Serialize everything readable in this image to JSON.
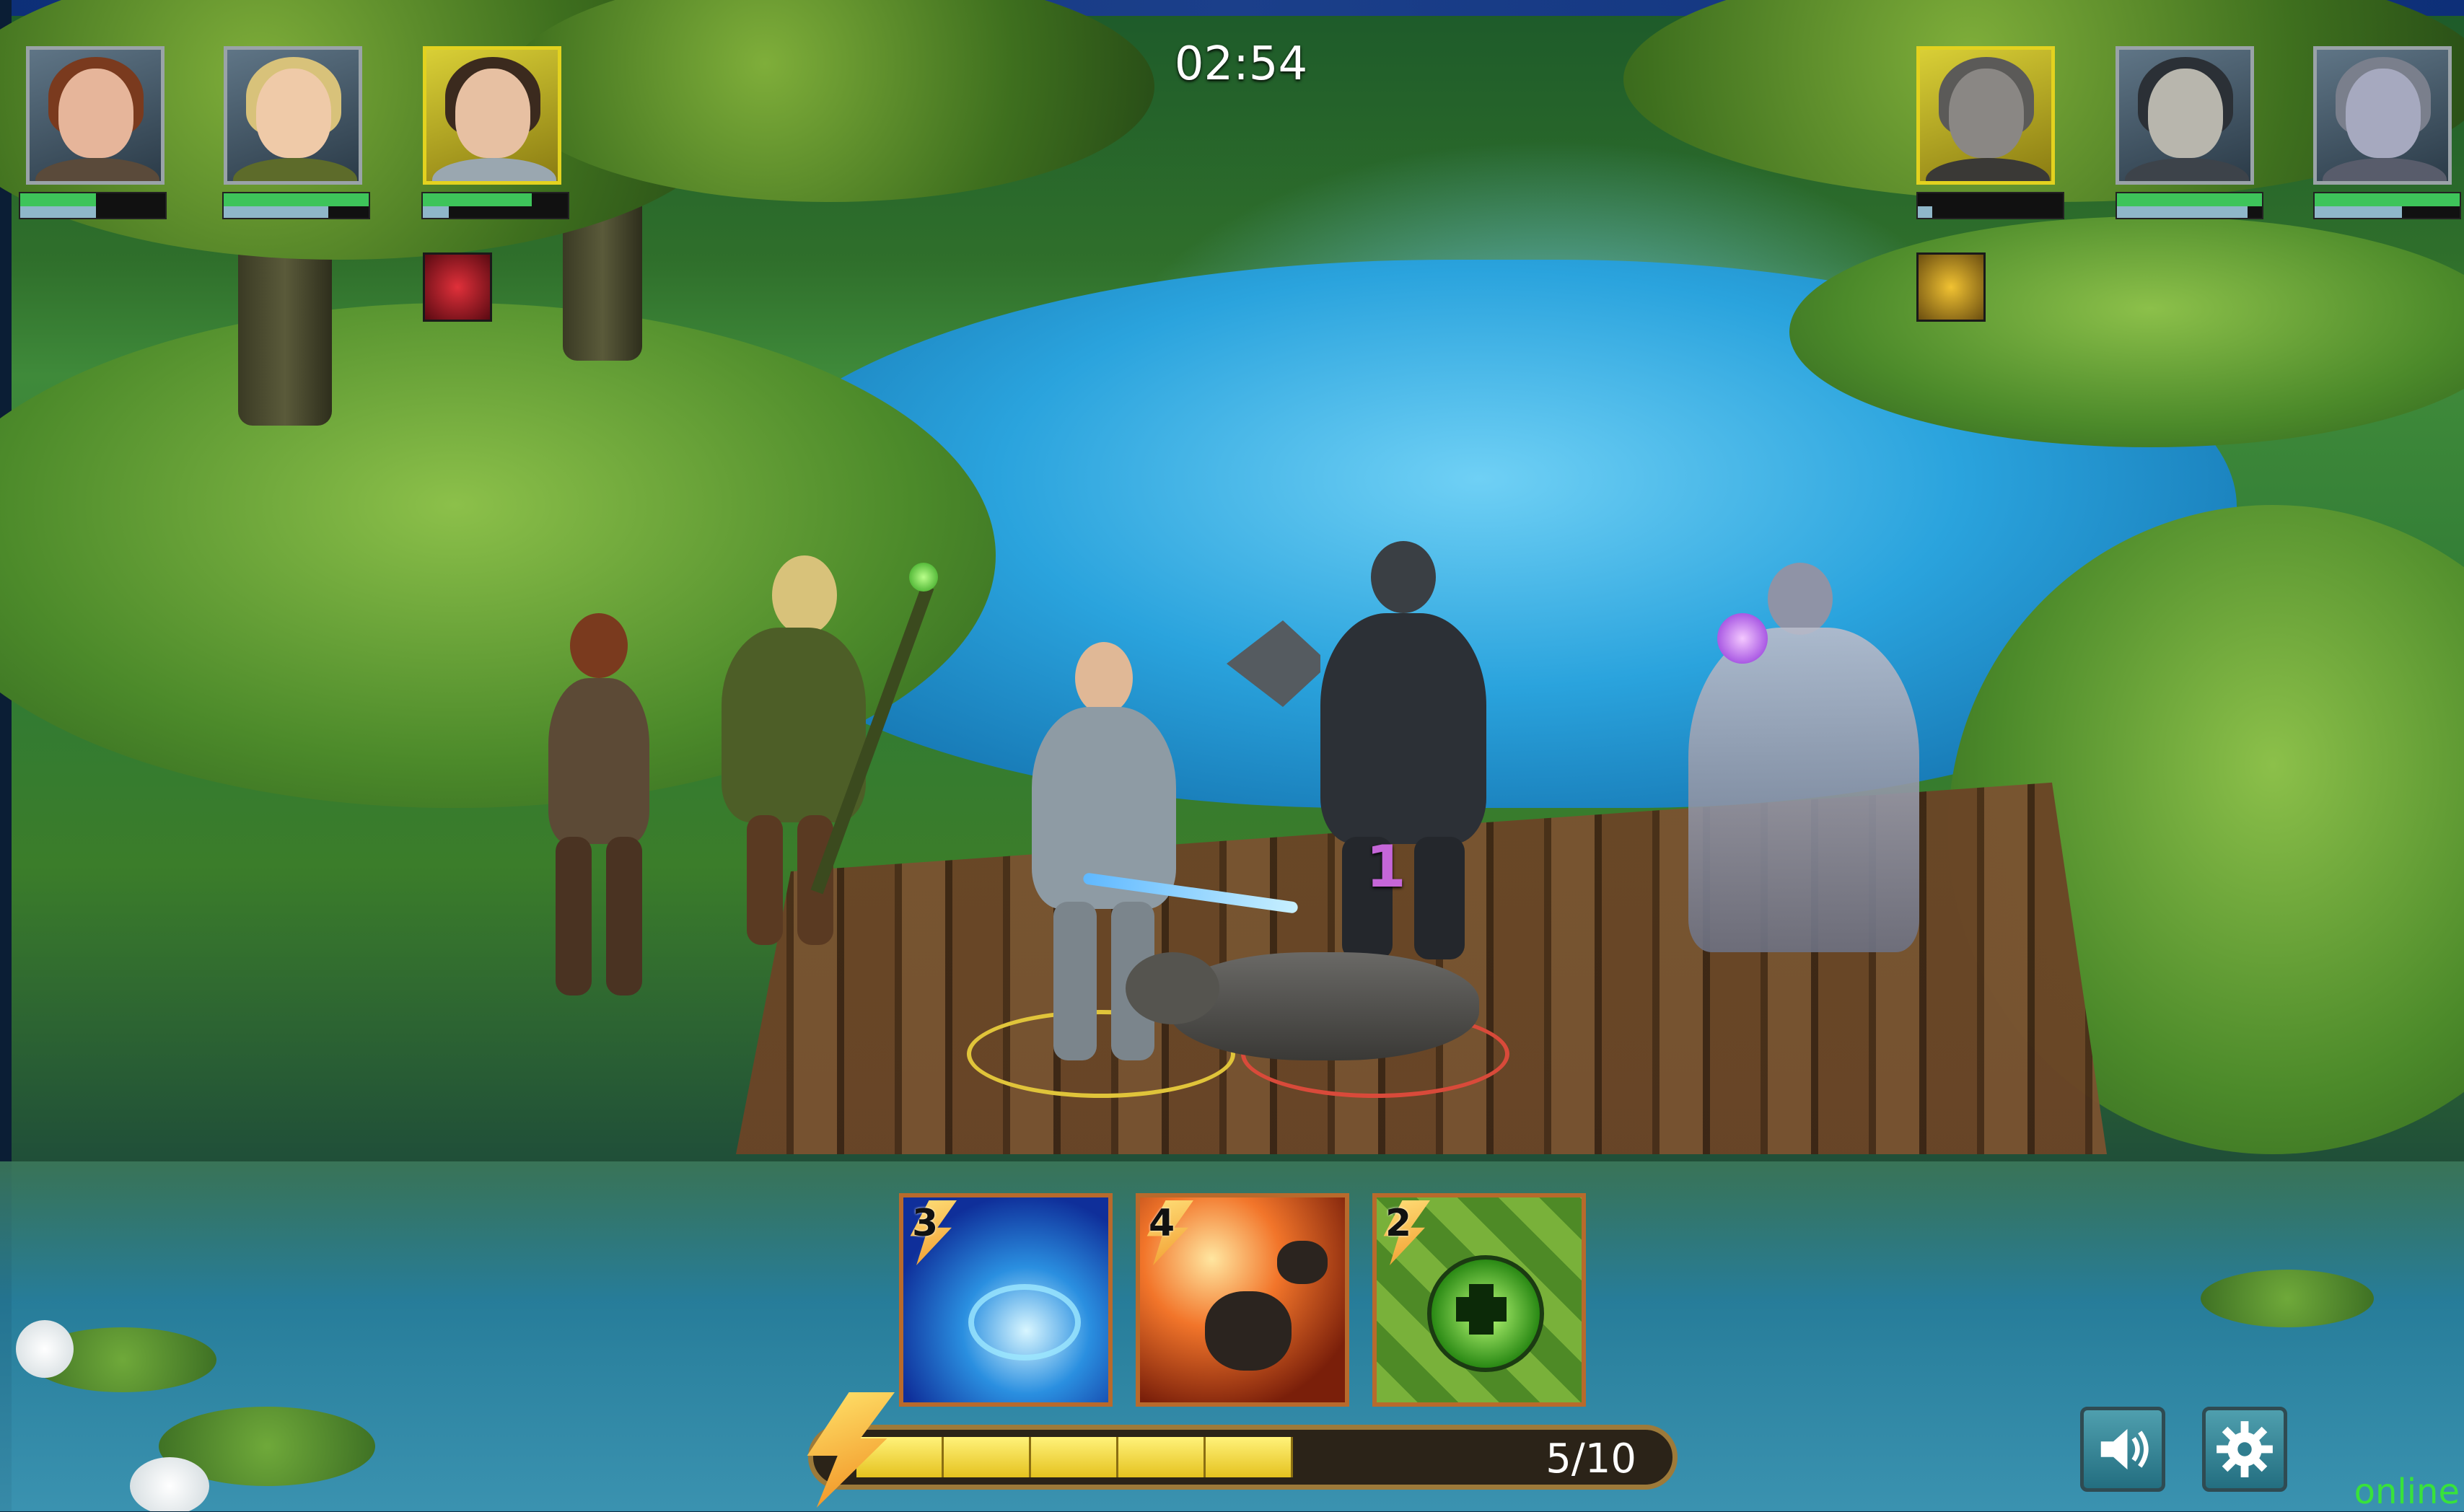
{
  "timer": "02:54",
  "energy": {
    "current": 5,
    "max": 10,
    "label": "5/10",
    "fraction": 0.5
  },
  "allies": [
    {
      "name": "archer-ranger",
      "active": false,
      "hp_fraction": 0.52,
      "shield_fraction": 0.52
    },
    {
      "name": "elf-druid",
      "active": false,
      "hp_fraction": 1.0,
      "shield_fraction": 0.72
    },
    {
      "name": "human-knight",
      "active": true,
      "hp_fraction": 0.75,
      "shield_fraction": 0.18
    }
  ],
  "enemies": [
    {
      "name": "werewolf",
      "active": true,
      "hp_fraction": 0.0,
      "shield_fraction": 0.1
    },
    {
      "name": "skeleton-warrior",
      "active": false,
      "hp_fraction": 1.0,
      "shield_fraction": 0.9
    },
    {
      "name": "banshee",
      "active": false,
      "hp_fraction": 1.0,
      "shield_fraction": 0.6
    }
  ],
  "status_effects": {
    "ally": "demon-curse-icon",
    "enemy": "golden-bell-icon"
  },
  "damage_number": "1",
  "skills": [
    {
      "cost": "3",
      "icon": "water-vortex-icon",
      "color": "#1d47c8"
    },
    {
      "cost": "4",
      "icon": "meteor-icon",
      "color": "#d8561c"
    },
    {
      "cost": "2",
      "icon": "heal-potion-icon",
      "color": "#4b9a2e"
    }
  ],
  "buttons": {
    "sound": "speaker-icon",
    "settings": "gear-icon"
  },
  "connection_status": "online"
}
